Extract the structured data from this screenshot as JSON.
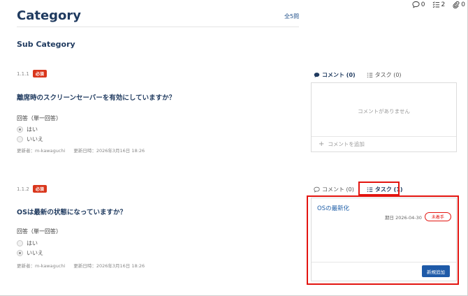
{
  "topbar": {
    "comments_count": "0",
    "tasks_count": "2",
    "attachments_count": "0"
  },
  "header": {
    "title": "Category",
    "total": "全5問",
    "sub_category": "Sub Category"
  },
  "questions": [
    {
      "number": "1.1.1",
      "required": "必須",
      "title": "離席時のスクリーンセーバーを有効にしていますか？",
      "answer_label": "回答（単一回答）",
      "options": [
        "はい",
        "いいえ"
      ],
      "selected_index": 0,
      "updated_by": "更新者：m-kawaguchi",
      "updated_at": "更新日時：2026年3月16日 18:26",
      "panel": {
        "comment_tab": "コメント (0)",
        "task_tab": "タスク (0)",
        "active_tab": "comment",
        "empty_message": "コメントがありません",
        "add_comment": "コメントを追加"
      }
    },
    {
      "number": "1.1.2",
      "required": "必須",
      "title": "OSは最新の状態になっていますか？",
      "answer_label": "回答（単一回答）",
      "options": [
        "はい",
        "いいえ"
      ],
      "selected_index": 1,
      "updated_by": "更新者：m-kawaguchi",
      "updated_at": "更新日時：2026年3月16日 18:26",
      "panel": {
        "comment_tab": "コメント (0)",
        "task_tab": "タスク (1)",
        "active_tab": "task",
        "task_name": "OSの最新化",
        "due_date": "期日 2026-04-30",
        "status": "未着手",
        "new_button": "新規追加"
      }
    }
  ],
  "colors": {
    "title": "#1f3a5f",
    "required_badge": "#d9361c",
    "highlight": "#e3140f",
    "primary_button": "#1e5aa8",
    "link": "#1f5fa8"
  }
}
